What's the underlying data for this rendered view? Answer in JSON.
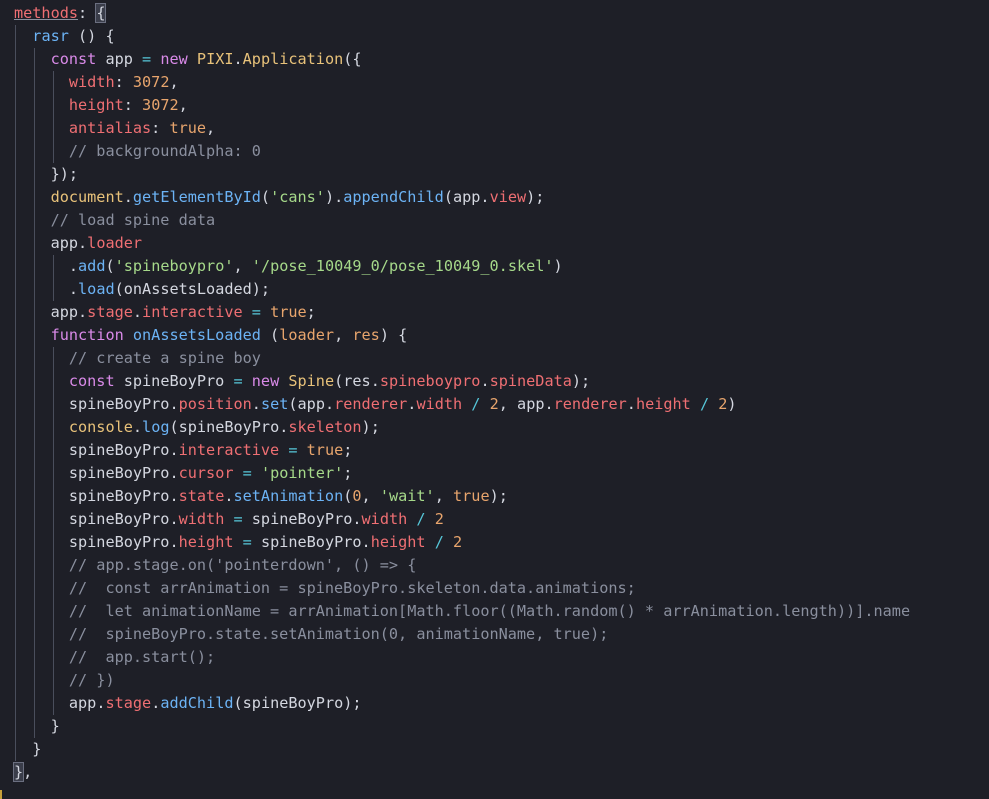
{
  "lines": [
    {
      "indent": 0,
      "tokens": [
        {
          "t": "methods",
          "c": "prop ul"
        },
        {
          "t": ": ",
          "c": "plain"
        },
        {
          "t": "{",
          "c": "plain bracket-hl"
        }
      ]
    },
    {
      "indent": 1,
      "tokens": [
        {
          "t": "rasr",
          "c": "fn"
        },
        {
          "t": " () {",
          "c": "plain"
        }
      ]
    },
    {
      "indent": 2,
      "tokens": [
        {
          "t": "const",
          "c": "kw"
        },
        {
          "t": " ",
          "c": "plain"
        },
        {
          "t": "app",
          "c": "plain"
        },
        {
          "t": " = ",
          "c": "op"
        },
        {
          "t": "new",
          "c": "kw"
        },
        {
          "t": " ",
          "c": "plain"
        },
        {
          "t": "PIXI",
          "c": "cls"
        },
        {
          "t": ".",
          "c": "plain"
        },
        {
          "t": "Application",
          "c": "cls"
        },
        {
          "t": "({",
          "c": "plain"
        }
      ]
    },
    {
      "indent": 3,
      "tokens": [
        {
          "t": "width",
          "c": "prop"
        },
        {
          "t": ": ",
          "c": "plain"
        },
        {
          "t": "3072",
          "c": "num"
        },
        {
          "t": ",",
          "c": "plain"
        }
      ]
    },
    {
      "indent": 3,
      "tokens": [
        {
          "t": "height",
          "c": "prop"
        },
        {
          "t": ": ",
          "c": "plain"
        },
        {
          "t": "3072",
          "c": "num"
        },
        {
          "t": ",",
          "c": "plain"
        }
      ]
    },
    {
      "indent": 3,
      "tokens": [
        {
          "t": "antialias",
          "c": "prop"
        },
        {
          "t": ": ",
          "c": "plain"
        },
        {
          "t": "true",
          "c": "num"
        },
        {
          "t": ",",
          "c": "plain"
        }
      ]
    },
    {
      "indent": 3,
      "tokens": [
        {
          "t": "// backgroundAlpha: 0",
          "c": "cm"
        }
      ]
    },
    {
      "indent": 2,
      "tokens": [
        {
          "t": "});",
          "c": "plain"
        }
      ]
    },
    {
      "indent": 2,
      "tokens": [
        {
          "t": "document",
          "c": "cls"
        },
        {
          "t": ".",
          "c": "plain"
        },
        {
          "t": "getElementById",
          "c": "fn"
        },
        {
          "t": "(",
          "c": "plain"
        },
        {
          "t": "'cans'",
          "c": "str"
        },
        {
          "t": ").",
          "c": "plain"
        },
        {
          "t": "appendChild",
          "c": "fn"
        },
        {
          "t": "(",
          "c": "plain"
        },
        {
          "t": "app",
          "c": "plain"
        },
        {
          "t": ".",
          "c": "plain"
        },
        {
          "t": "view",
          "c": "prop"
        },
        {
          "t": ");",
          "c": "plain"
        }
      ]
    },
    {
      "indent": 2,
      "tokens": [
        {
          "t": "// load spine data",
          "c": "cm"
        }
      ]
    },
    {
      "indent": 2,
      "tokens": [
        {
          "t": "app",
          "c": "plain"
        },
        {
          "t": ".",
          "c": "plain"
        },
        {
          "t": "loader",
          "c": "prop"
        }
      ]
    },
    {
      "indent": 3,
      "tokens": [
        {
          "t": ".",
          "c": "plain"
        },
        {
          "t": "add",
          "c": "fn"
        },
        {
          "t": "(",
          "c": "plain"
        },
        {
          "t": "'spineboypro'",
          "c": "str"
        },
        {
          "t": ", ",
          "c": "plain"
        },
        {
          "t": "'/pose_10049_0/pose_10049_0.skel'",
          "c": "str"
        },
        {
          "t": ")",
          "c": "plain"
        }
      ]
    },
    {
      "indent": 3,
      "tokens": [
        {
          "t": ".",
          "c": "plain"
        },
        {
          "t": "load",
          "c": "fn"
        },
        {
          "t": "(",
          "c": "plain"
        },
        {
          "t": "onAssetsLoaded",
          "c": "plain"
        },
        {
          "t": ");",
          "c": "plain"
        }
      ]
    },
    {
      "indent": 2,
      "tokens": [
        {
          "t": "app",
          "c": "plain"
        },
        {
          "t": ".",
          "c": "plain"
        },
        {
          "t": "stage",
          "c": "prop"
        },
        {
          "t": ".",
          "c": "plain"
        },
        {
          "t": "interactive",
          "c": "prop"
        },
        {
          "t": " = ",
          "c": "op"
        },
        {
          "t": "true",
          "c": "num"
        },
        {
          "t": ";",
          "c": "plain"
        }
      ]
    },
    {
      "indent": 2,
      "tokens": [
        {
          "t": "function",
          "c": "kw"
        },
        {
          "t": " ",
          "c": "plain"
        },
        {
          "t": "onAssetsLoaded",
          "c": "fn"
        },
        {
          "t": " (",
          "c": "plain"
        },
        {
          "t": "loader",
          "c": "param"
        },
        {
          "t": ", ",
          "c": "plain"
        },
        {
          "t": "res",
          "c": "param"
        },
        {
          "t": ") {",
          "c": "plain"
        }
      ]
    },
    {
      "indent": 3,
      "tokens": [
        {
          "t": "// create a spine boy",
          "c": "cm"
        }
      ]
    },
    {
      "indent": 3,
      "tokens": [
        {
          "t": "const",
          "c": "kw"
        },
        {
          "t": " ",
          "c": "plain"
        },
        {
          "t": "spineBoyPro",
          "c": "plain"
        },
        {
          "t": " = ",
          "c": "op"
        },
        {
          "t": "new",
          "c": "kw"
        },
        {
          "t": " ",
          "c": "plain"
        },
        {
          "t": "Spine",
          "c": "cls"
        },
        {
          "t": "(",
          "c": "plain"
        },
        {
          "t": "res",
          "c": "plain"
        },
        {
          "t": ".",
          "c": "plain"
        },
        {
          "t": "spineboypro",
          "c": "prop"
        },
        {
          "t": ".",
          "c": "plain"
        },
        {
          "t": "spineData",
          "c": "prop"
        },
        {
          "t": ");",
          "c": "plain"
        }
      ]
    },
    {
      "indent": 3,
      "tokens": [
        {
          "t": "spineBoyPro",
          "c": "plain"
        },
        {
          "t": ".",
          "c": "plain"
        },
        {
          "t": "position",
          "c": "prop"
        },
        {
          "t": ".",
          "c": "plain"
        },
        {
          "t": "set",
          "c": "fn"
        },
        {
          "t": "(",
          "c": "plain"
        },
        {
          "t": "app",
          "c": "plain"
        },
        {
          "t": ".",
          "c": "plain"
        },
        {
          "t": "renderer",
          "c": "prop"
        },
        {
          "t": ".",
          "c": "plain"
        },
        {
          "t": "width",
          "c": "prop"
        },
        {
          "t": " / ",
          "c": "op"
        },
        {
          "t": "2",
          "c": "num"
        },
        {
          "t": ", ",
          "c": "plain"
        },
        {
          "t": "app",
          "c": "plain"
        },
        {
          "t": ".",
          "c": "plain"
        },
        {
          "t": "renderer",
          "c": "prop"
        },
        {
          "t": ".",
          "c": "plain"
        },
        {
          "t": "height",
          "c": "prop"
        },
        {
          "t": " / ",
          "c": "op"
        },
        {
          "t": "2",
          "c": "num"
        },
        {
          "t": ")",
          "c": "plain"
        }
      ]
    },
    {
      "indent": 3,
      "tokens": [
        {
          "t": "console",
          "c": "cls"
        },
        {
          "t": ".",
          "c": "plain"
        },
        {
          "t": "log",
          "c": "fn"
        },
        {
          "t": "(",
          "c": "plain"
        },
        {
          "t": "spineBoyPro",
          "c": "plain"
        },
        {
          "t": ".",
          "c": "plain"
        },
        {
          "t": "skeleton",
          "c": "prop"
        },
        {
          "t": ");",
          "c": "plain"
        }
      ]
    },
    {
      "indent": 3,
      "tokens": [
        {
          "t": "spineBoyPro",
          "c": "plain"
        },
        {
          "t": ".",
          "c": "plain"
        },
        {
          "t": "interactive",
          "c": "prop"
        },
        {
          "t": " = ",
          "c": "op"
        },
        {
          "t": "true",
          "c": "num"
        },
        {
          "t": ";",
          "c": "plain"
        }
      ]
    },
    {
      "indent": 3,
      "tokens": [
        {
          "t": "spineBoyPro",
          "c": "plain"
        },
        {
          "t": ".",
          "c": "plain"
        },
        {
          "t": "cursor",
          "c": "prop"
        },
        {
          "t": " = ",
          "c": "op"
        },
        {
          "t": "'pointer'",
          "c": "str"
        },
        {
          "t": ";",
          "c": "plain"
        }
      ]
    },
    {
      "indent": 3,
      "tokens": [
        {
          "t": "spineBoyPro",
          "c": "plain"
        },
        {
          "t": ".",
          "c": "plain"
        },
        {
          "t": "state",
          "c": "prop"
        },
        {
          "t": ".",
          "c": "plain"
        },
        {
          "t": "setAnimation",
          "c": "fn"
        },
        {
          "t": "(",
          "c": "plain"
        },
        {
          "t": "0",
          "c": "num"
        },
        {
          "t": ", ",
          "c": "plain"
        },
        {
          "t": "'wait'",
          "c": "str"
        },
        {
          "t": ", ",
          "c": "plain"
        },
        {
          "t": "true",
          "c": "num"
        },
        {
          "t": ");",
          "c": "plain"
        }
      ]
    },
    {
      "indent": 3,
      "tokens": [
        {
          "t": "spineBoyPro",
          "c": "plain"
        },
        {
          "t": ".",
          "c": "plain"
        },
        {
          "t": "width",
          "c": "prop"
        },
        {
          "t": " = ",
          "c": "op"
        },
        {
          "t": "spineBoyPro",
          "c": "plain"
        },
        {
          "t": ".",
          "c": "plain"
        },
        {
          "t": "width",
          "c": "prop"
        },
        {
          "t": " / ",
          "c": "op"
        },
        {
          "t": "2",
          "c": "num"
        }
      ]
    },
    {
      "indent": 3,
      "tokens": [
        {
          "t": "spineBoyPro",
          "c": "plain"
        },
        {
          "t": ".",
          "c": "plain"
        },
        {
          "t": "height",
          "c": "prop"
        },
        {
          "t": " = ",
          "c": "op"
        },
        {
          "t": "spineBoyPro",
          "c": "plain"
        },
        {
          "t": ".",
          "c": "plain"
        },
        {
          "t": "height",
          "c": "prop"
        },
        {
          "t": " / ",
          "c": "op"
        },
        {
          "t": "2",
          "c": "num"
        }
      ]
    },
    {
      "indent": 3,
      "tokens": [
        {
          "t": "// app.stage.on('pointerdown', () => {",
          "c": "cm"
        }
      ]
    },
    {
      "indent": 3,
      "tokens": [
        {
          "t": "//  const arrAnimation = spineBoyPro.skeleton.data.animations;",
          "c": "cm"
        }
      ]
    },
    {
      "indent": 3,
      "tokens": [
        {
          "t": "//  let animationName = arrAnimation[Math.floor((Math.random() * arrAnimation.length))].name",
          "c": "cm"
        }
      ]
    },
    {
      "indent": 3,
      "tokens": [
        {
          "t": "//  spineBoyPro.state.setAnimation(0, animationName, true);",
          "c": "cm"
        }
      ]
    },
    {
      "indent": 3,
      "tokens": [
        {
          "t": "//  app.start();",
          "c": "cm"
        }
      ]
    },
    {
      "indent": 3,
      "tokens": [
        {
          "t": "// })",
          "c": "cm"
        }
      ]
    },
    {
      "indent": 3,
      "tokens": [
        {
          "t": "app",
          "c": "plain"
        },
        {
          "t": ".",
          "c": "plain"
        },
        {
          "t": "stage",
          "c": "prop"
        },
        {
          "t": ".",
          "c": "plain"
        },
        {
          "t": "addChild",
          "c": "fn"
        },
        {
          "t": "(",
          "c": "plain"
        },
        {
          "t": "spineBoyPro",
          "c": "plain"
        },
        {
          "t": ");",
          "c": "plain"
        }
      ]
    },
    {
      "indent": 2,
      "tokens": [
        {
          "t": "}",
          "c": "plain"
        }
      ]
    },
    {
      "indent": 1,
      "tokens": [
        {
          "t": "}",
          "c": "plain"
        }
      ]
    },
    {
      "indent": 0,
      "tokens": [
        {
          "t": "}",
          "c": "plain bracket-hl"
        },
        {
          "t": ",",
          "c": "plain"
        }
      ]
    }
  ],
  "colors": {
    "background": "#1e1f27",
    "keyword": "#d98ae8",
    "class": "#e8c27a",
    "function": "#6cb3f5",
    "property": "#ef6f73",
    "number": "#e8a56d",
    "string": "#a6d98a",
    "comment": "#8a8f9e"
  }
}
